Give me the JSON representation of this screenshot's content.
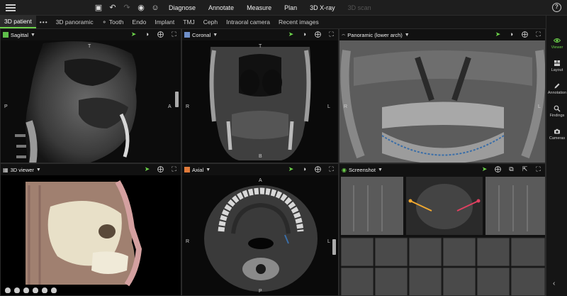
{
  "toolbar": {
    "menu": [
      "Diagnose",
      "Annotate",
      "Measure",
      "Plan",
      "3D X-ray",
      "3D scan"
    ]
  },
  "tabs": [
    "3D patient",
    "•••",
    "3D panoramic",
    "Tooth",
    "Endo",
    "Implant",
    "TMJ",
    "Ceph",
    "Intraoral camera",
    "Recent images"
  ],
  "sidebar": {
    "items": [
      {
        "label": "Viewer",
        "icon": "eye-icon"
      },
      {
        "label": "Layout",
        "icon": "layout-icon"
      },
      {
        "label": "Annotation",
        "icon": "pencil-icon"
      },
      {
        "label": "Findings",
        "icon": "magnify-icon"
      },
      {
        "label": "Cameras",
        "icon": "camera-icon"
      }
    ],
    "collapse": "‹"
  },
  "panels": {
    "sagittal": {
      "title": "Sagittal",
      "color": "#5fbf4a",
      "labels": {
        "top": "T",
        "left": "P",
        "right": "A"
      }
    },
    "coronal": {
      "title": "Coronal",
      "color": "#6f8fc8",
      "labels": {
        "top": "T",
        "left": "R",
        "right": "L",
        "bottom": "B"
      }
    },
    "panoramic": {
      "title": "Panoramic (lower arch)",
      "labels": {
        "left": "R",
        "right": "L"
      }
    },
    "viewer3d": {
      "title": "3D viewer"
    },
    "axial": {
      "title": "Axial",
      "color": "#e07a3a",
      "labels": {
        "top": "A",
        "left": "R",
        "right": "L",
        "bottom": "P"
      }
    },
    "screenshot": {
      "title": "Screenshot"
    }
  }
}
